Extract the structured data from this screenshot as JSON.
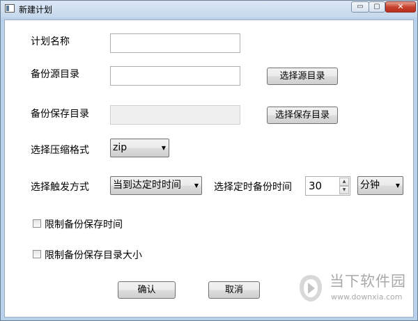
{
  "window": {
    "title": "新建计划",
    "controls": {
      "minimize": "▭",
      "maximize": "▢",
      "close": "✕"
    }
  },
  "form": {
    "plan_name_label": "计划名称",
    "plan_name_value": "",
    "source_dir_label": "备份源目录",
    "source_dir_value": "",
    "choose_source_button": "选择源目录",
    "save_dir_label": "备份保存目录",
    "save_dir_value": "",
    "choose_save_button": "选择保存目录",
    "compress_label": "选择压缩格式",
    "compress_selected": "zip",
    "trigger_label": "选择触发方式",
    "trigger_selected": "当到达定时时间",
    "interval_label": "选择定时备份时间",
    "interval_value": "30",
    "unit_selected": "分钟",
    "limit_time_label": "限制备份保存时间",
    "limit_time_checked": false,
    "limit_size_label": "限制备份保存目录大小",
    "limit_size_checked": false,
    "confirm_button": "确认",
    "cancel_button": "取消"
  },
  "watermark": {
    "text": "当下软件园",
    "url": "www.downxia.com"
  },
  "colors": {
    "frame": "#b9d1ea",
    "accent_close": "#c6432e",
    "watermark_gray": "#a9a9a9"
  }
}
